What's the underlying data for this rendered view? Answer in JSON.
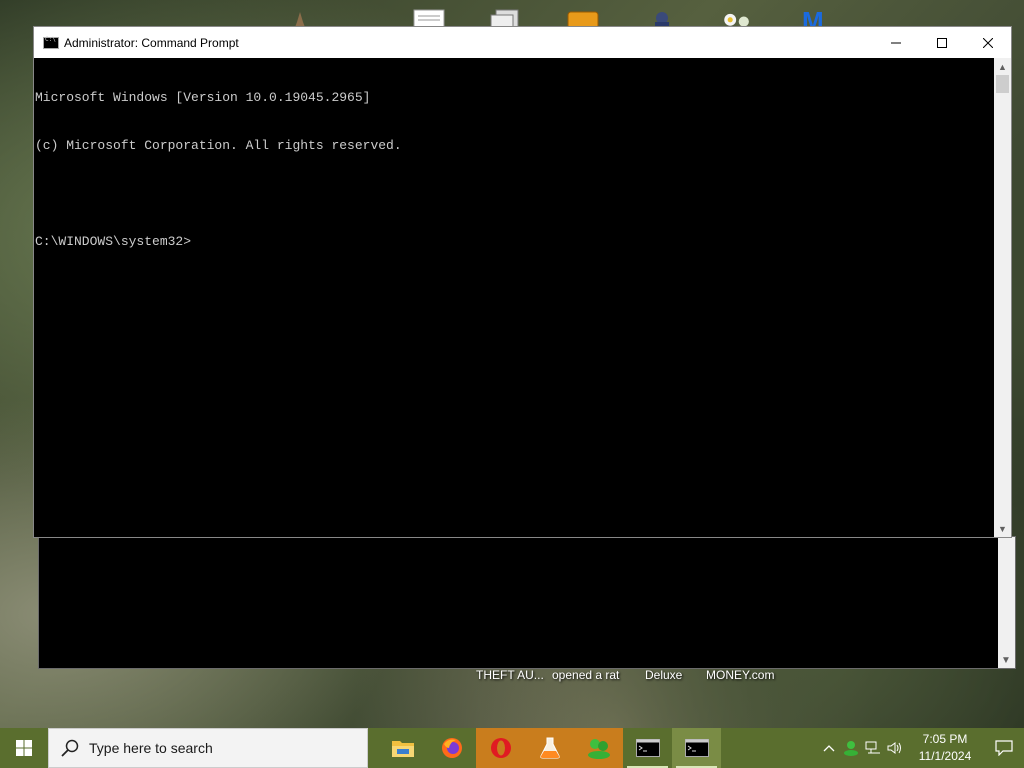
{
  "window": {
    "title": "Administrator: Command Prompt",
    "minimize": "—",
    "maximize": "☐",
    "close": "✕"
  },
  "console": {
    "lines": [
      "Microsoft Windows [Version 10.0.19045.2965]",
      "(c) Microsoft Corporation. All rights reserved.",
      "",
      "C:\\WINDOWS\\system32>"
    ]
  },
  "desktop": {
    "labels": [
      "THEFT AU...",
      "opened a rat",
      "Deluxe",
      "MONEY.com"
    ]
  },
  "taskbar": {
    "search_placeholder": "Type here to search",
    "apps": [
      {
        "name": "file-explorer-icon"
      },
      {
        "name": "firefox-icon"
      },
      {
        "name": "opera-icon"
      },
      {
        "name": "flask-app-icon"
      },
      {
        "name": "green-people-app-icon"
      },
      {
        "name": "command-prompt-icon"
      },
      {
        "name": "command-prompt-icon"
      }
    ],
    "clock": {
      "time": "7:05 PM",
      "date": "11/1/2024"
    }
  },
  "colors": {
    "taskbar": "#5a6e2e",
    "active_app": "#c97d1d",
    "console_text": "#cccccc"
  }
}
